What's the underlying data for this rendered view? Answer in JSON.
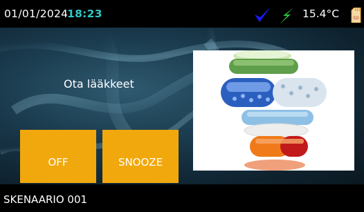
{
  "status_bar": {
    "date": "01/01/2024",
    "time": "18:23",
    "temperature": "15.4°C",
    "icons": [
      "checkmark-icon",
      "charging-bolt-icon",
      "sd-card-icon"
    ],
    "sd_label": "SD",
    "colors": {
      "time": "#2ec8c8",
      "check": "#1a1aff",
      "bolt": "#2fbf3a",
      "sd": "#e8a020"
    }
  },
  "main": {
    "message": "Ota lääkkeet",
    "buttons": {
      "off_label": "OFF",
      "snooze_label": "SNOOZE"
    },
    "button_color": "#f1a80d",
    "image": "stacked-pills-image"
  },
  "bottom_bar": {
    "scenario": "SKENAARIO 001"
  }
}
